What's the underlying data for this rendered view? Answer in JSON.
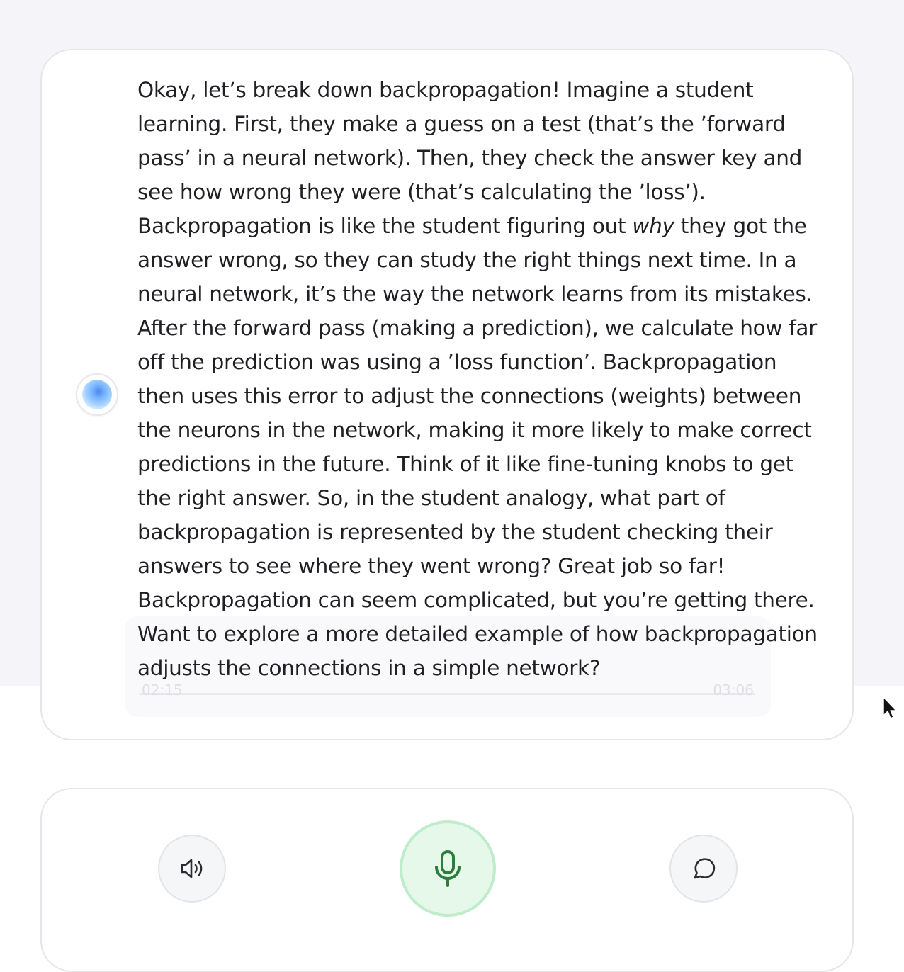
{
  "message": {
    "text_before_emphasis": "Okay, let’s break down backpropagation! Imagine a student learning. First, they make a guess on a test (that’s the ’forward pass’ in a neural network). Then, they check the answer key and see how wrong they were (that’s calculating the ’loss’). Backpropagation is like the student figuring out",
    "emphasis": "why",
    "text_after_emphasis": "they got the answer wrong, so they can study the right things next time. In a neural network, it’s the way the network learns from its mistakes. After the forward pass (making a prediction), we calculate how far off the prediction was using a ’loss function’. Backpropagation then uses this error to adjust the connections (weights) between the neurons in the network, making it more likely to make correct predictions in the future. Think of it like fine-tuning knobs to get the right answer. So, in the student analogy, what part of backpropagation is represented by the student checking their answers to see where they went wrong? Great job so far! Backpropagation can seem complicated, but you’re getting there. Want to explore a more detailed example of how backpropagation adjusts the connections in a simple network?"
  },
  "ghost_player": {
    "elapsed": "02:15",
    "duration": "03:06"
  },
  "controls": {
    "speaker_icon": "speaker-volume-icon",
    "mic_icon": "microphone-icon",
    "chat_icon": "chat-bubble-icon",
    "mic_color": "#2e7d3a",
    "icon_color": "#2b2b30"
  },
  "colors": {
    "page_background": "#f4f4f9",
    "card_background": "#ffffff",
    "mic_background": "#e6f8ea"
  }
}
